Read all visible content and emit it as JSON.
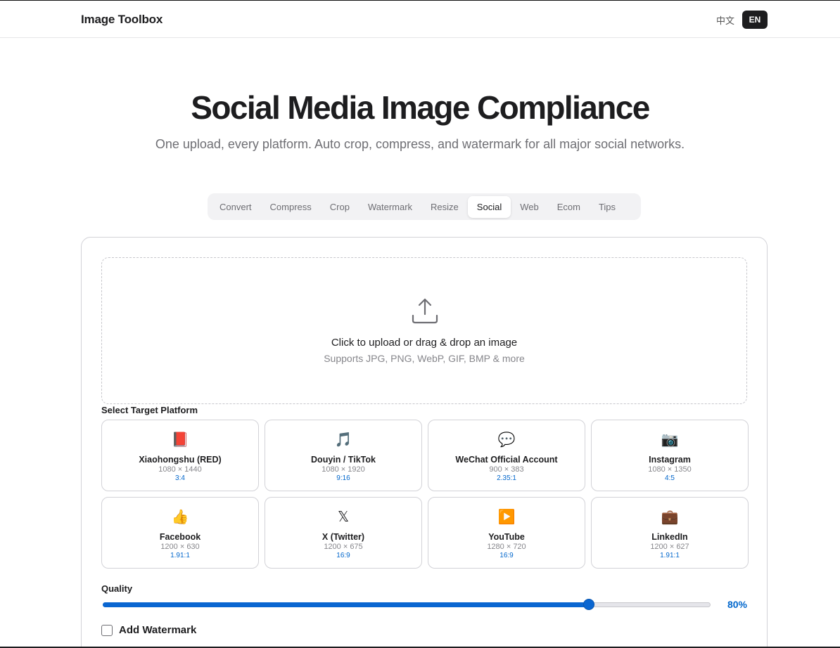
{
  "header": {
    "brand": "Image Toolbox",
    "lang_zh": "中文",
    "lang_en": "EN"
  },
  "hero": {
    "title": "Social Media Image Compliance",
    "subtitle": "One upload, every platform. Auto crop, compress, and watermark for all major social networks."
  },
  "tabs": [
    {
      "label": "Convert"
    },
    {
      "label": "Compress"
    },
    {
      "label": "Crop"
    },
    {
      "label": "Watermark"
    },
    {
      "label": "Resize"
    },
    {
      "label": "Social",
      "active": true
    },
    {
      "label": "Web"
    },
    {
      "label": "Ecom"
    },
    {
      "label": "Tips"
    }
  ],
  "upload": {
    "icon": "upload-icon",
    "title": "Click to upload or drag & drop an image",
    "hint": "Supports JPG, PNG, WebP, GIF, BMP & more"
  },
  "platforms": {
    "label": "Select Target Platform",
    "items": [
      {
        "emoji": "📕",
        "name": "Xiaohongshu (RED)",
        "dims": "1080 × 1440",
        "ratio": "3:4"
      },
      {
        "emoji": "🎵",
        "name": "Douyin / TikTok",
        "dims": "1080 × 1920",
        "ratio": "9:16"
      },
      {
        "emoji": "💬",
        "name": "WeChat Official Account",
        "dims": "900 × 383",
        "ratio": "2.35:1"
      },
      {
        "emoji": "📷",
        "name": "Instagram",
        "dims": "1080 × 1350",
        "ratio": "4:5"
      },
      {
        "emoji": "👍",
        "name": "Facebook",
        "dims": "1200 × 630",
        "ratio": "1.91:1"
      },
      {
        "emoji": "𝕏",
        "name": "X (Twitter)",
        "dims": "1200 × 675",
        "ratio": "16:9"
      },
      {
        "emoji": "▶️",
        "name": "YouTube",
        "dims": "1280 × 720",
        "ratio": "16:9"
      },
      {
        "emoji": "💼",
        "name": "LinkedIn",
        "dims": "1200 × 627",
        "ratio": "1.91:1"
      }
    ]
  },
  "quality": {
    "label": "Quality",
    "value": 80,
    "value_text": "80%"
  },
  "watermark": {
    "label": "Add Watermark",
    "checked": false
  },
  "colors": {
    "accent": "#0a66d1",
    "link": "#0066cc",
    "text": "#1d1d1f",
    "muted": "#86868b"
  }
}
